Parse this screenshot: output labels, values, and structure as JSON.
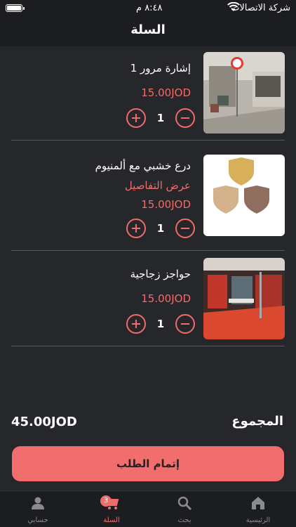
{
  "status_bar": {
    "carrier": "شركة الاتصالات",
    "time": "٨:٤٨ م"
  },
  "header": {
    "title": "السلة"
  },
  "cart": {
    "items": [
      {
        "name": "إشارة مرور 1",
        "price": "15.00JOD",
        "quantity": "1",
        "image": "traffic-sign-photo"
      },
      {
        "name": "درع خشبي مع ألمنيوم",
        "details_link": "عرض التفاصيل",
        "price": "15.00JOD",
        "quantity": "1",
        "image": "wooden-shields-photo"
      },
      {
        "name": "حواجز زجاجية",
        "price": "15.00JOD",
        "quantity": "1",
        "image": "glass-partitions-photo"
      }
    ]
  },
  "summary": {
    "total_label": "المجموع",
    "total_value": "45.00JOD"
  },
  "checkout": {
    "label": "إتمام الطلب"
  },
  "tabbar": {
    "tabs": [
      {
        "label": "الرئيسية",
        "icon": "home-icon"
      },
      {
        "label": "بحث",
        "icon": "search-icon"
      },
      {
        "label": "السلة",
        "icon": "cart-icon",
        "badge": "3",
        "active": true
      },
      {
        "label": "حسابي",
        "icon": "user-icon"
      }
    ]
  },
  "colors": {
    "accent": "#f06c6c",
    "background": "#26272b",
    "bar": "#1c1d20",
    "button": "#f26e6e"
  }
}
